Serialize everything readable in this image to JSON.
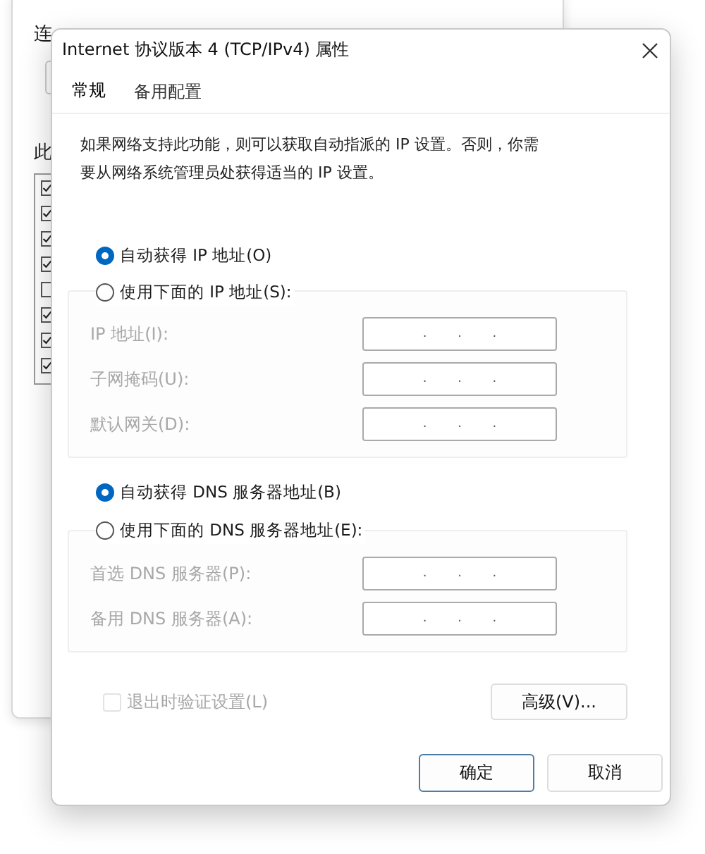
{
  "background_window": {
    "labels": [
      "连",
      "此"
    ],
    "list_items": [
      {
        "checked": true
      },
      {
        "checked": true
      },
      {
        "checked": true
      },
      {
        "checked": true
      },
      {
        "checked": false
      },
      {
        "checked": true
      },
      {
        "checked": true
      },
      {
        "checked": true
      }
    ]
  },
  "dialog": {
    "title": "Internet 协议版本 4 (TCP/IPv4) 属性",
    "tabs": [
      {
        "label": "常规",
        "selected": true
      },
      {
        "label": "备用配置",
        "selected": false
      }
    ],
    "description": "如果网络支持此功能，则可以获取自动指派的 IP 设置。否则，你需要从网络系统管理员处获得适当的 IP 设置。",
    "ip_options": [
      {
        "label": "自动获得 IP 地址(O)",
        "selected": true
      },
      {
        "label": "使用下面的 IP 地址(S):",
        "selected": false
      }
    ],
    "ip_fields": {
      "disabled": true,
      "rows": [
        {
          "label": "IP 地址(I):",
          "separators": [
            ".",
            ".",
            "."
          ]
        },
        {
          "label": "子网掩码(U):",
          "separators": [
            ".",
            ".",
            "."
          ]
        },
        {
          "label": "默认网关(D):",
          "separators": [
            ".",
            ".",
            "."
          ]
        }
      ]
    },
    "dns_options": [
      {
        "label": "自动获得 DNS 服务器地址(B)",
        "selected": true
      },
      {
        "label": "使用下面的 DNS 服务器地址(E):",
        "selected": false
      }
    ],
    "dns_fields": {
      "disabled": true,
      "rows": [
        {
          "label": "首选 DNS 服务器(P):",
          "separators": [
            ".",
            ".",
            "."
          ]
        },
        {
          "label": "备用 DNS 服务器(A):",
          "separators": [
            ".",
            ".",
            "."
          ]
        }
      ]
    },
    "validate_on_exit": {
      "label": "退出时验证设置(L)",
      "checked": false,
      "disabled": true
    },
    "advanced_button": "高级(V)...",
    "buttons": [
      {
        "label": "确定",
        "default": true
      },
      {
        "label": "取消",
        "default": false
      }
    ]
  }
}
